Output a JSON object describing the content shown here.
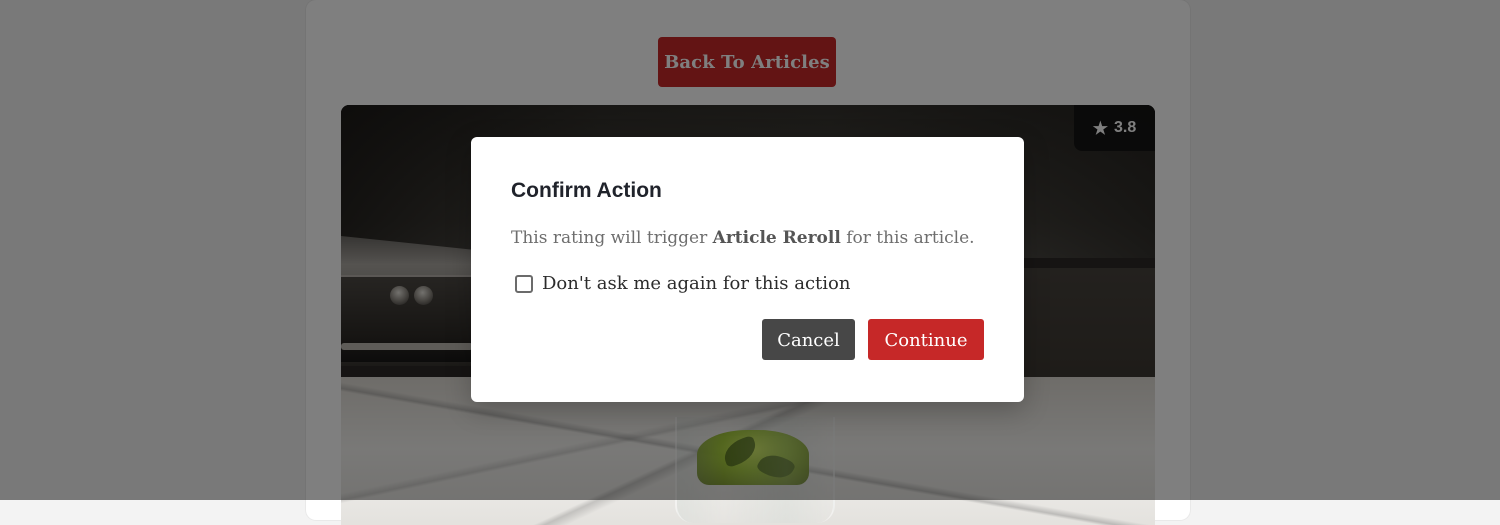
{
  "page": {
    "back_button_label": "Back To Articles",
    "rating": "3.8"
  },
  "icons": {
    "rating_icon": "star-icon"
  },
  "modal": {
    "title": "Confirm Action",
    "message": {
      "prefix": "This rating will trigger ",
      "action": "Article Reroll",
      "suffix": " for this article."
    },
    "checkbox": {
      "label": "Don't ask me again for this action",
      "checked": false
    },
    "buttons": {
      "cancel": "Cancel",
      "continue": "Continue"
    }
  },
  "colors": {
    "primary_red": "#c62828",
    "cancel_gray": "#474747",
    "overlay": "rgba(0,0,0,0.5)"
  }
}
